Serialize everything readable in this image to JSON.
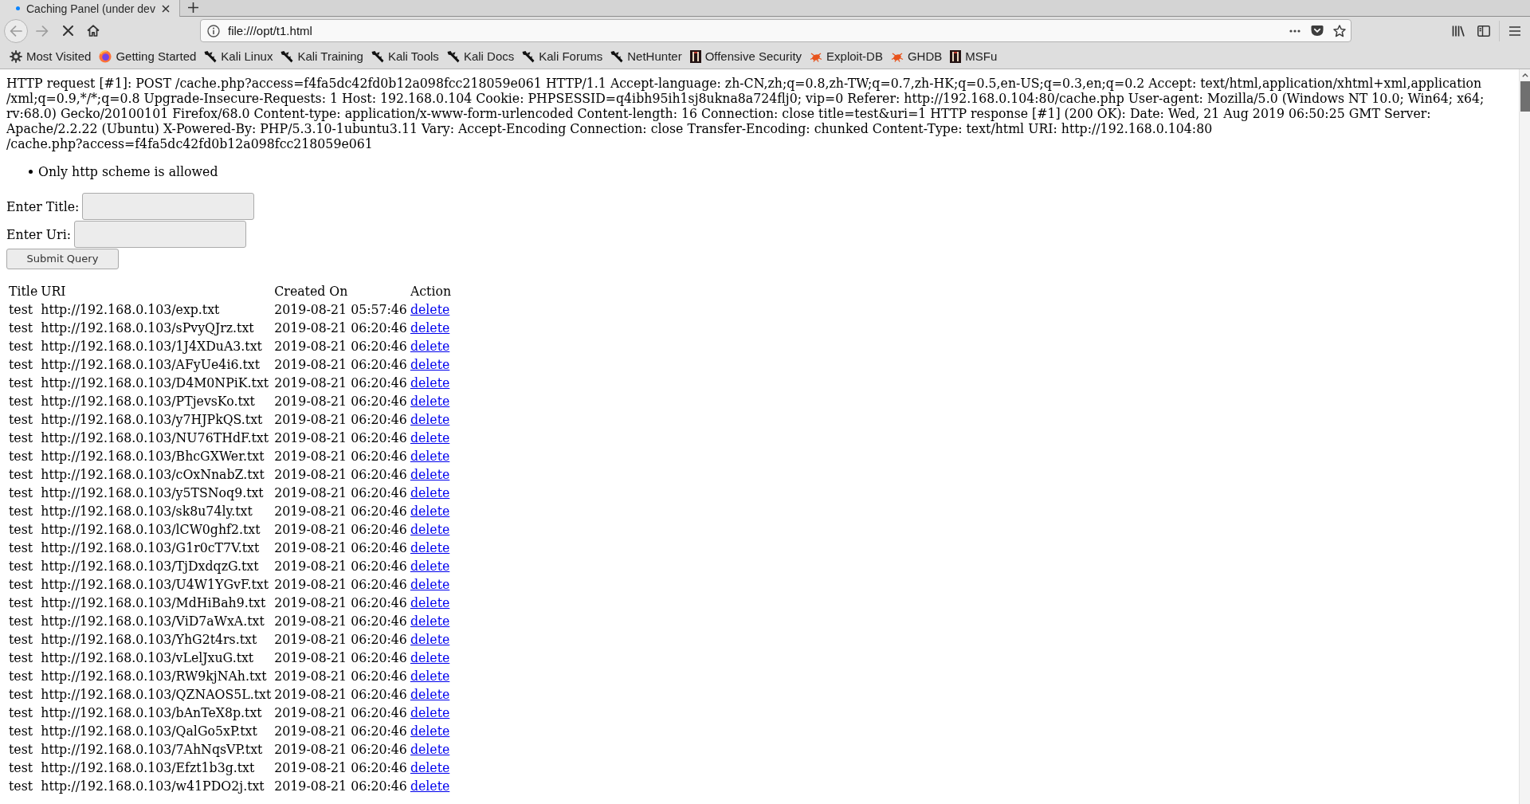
{
  "browser": {
    "tabs": [
      {
        "title": "Caching Panel (under dev",
        "selected": true
      }
    ],
    "navigation": {
      "back_disabled": true,
      "forward_disabled": true,
      "loading": true
    },
    "address": {
      "value": "file:///opt/t1.html"
    },
    "bookmarks": [
      {
        "label": "Most Visited",
        "kind": "gear"
      },
      {
        "label": "Getting Started",
        "kind": "globe"
      },
      {
        "label": "Kali Linux",
        "kind": "dragon"
      },
      {
        "label": "Kali Training",
        "kind": "dragon"
      },
      {
        "label": "Kali Tools",
        "kind": "dragon"
      },
      {
        "label": "Kali Docs",
        "kind": "dragon"
      },
      {
        "label": "Kali Forums",
        "kind": "dragon"
      },
      {
        "label": "NetHunter",
        "kind": "dragon"
      },
      {
        "label": "Offensive Security",
        "kind": "tile"
      },
      {
        "label": "Exploit-DB",
        "kind": "bug"
      },
      {
        "label": "GHDB",
        "kind": "bug"
      },
      {
        "label": "MSFu",
        "kind": "tile"
      }
    ]
  },
  "page": {
    "request_log": {
      "lines": [
        "HTTP request [#1]: POST /cache.php?access=f4fa5dc42fd0b12a098fcc218059e061 HTTP/1.1 Accept-language: zh-CN,zh;q=0.8,zh-TW;q=0.7,zh-HK;q=0.5,en-US;q=0.3,en;q=0.2 Accept: text/html,application/xhtml+xml,application",
        "/xml;q=0.9,*/*;q=0.8 Upgrade-Insecure-Requests: 1 Host: 192.168.0.104 Cookie: PHPSESSID=q4ibh95ih1sj8ukna8a724flj0; vip=0 Referer: http://192.168.0.104:80/cache.php User-agent: Mozilla/5.0 (Windows NT 10.0; Win64; x64;",
        "rv:68.0) Gecko/20100101 Firefox/68.0 Content-type: application/x-www-form-urlencoded Content-length: 16 Connection: close title=test&uri=1 HTTP response [#1] (200 OK): Date: Wed, 21 Aug 2019 06:50:25 GMT Server:",
        "Apache/2.2.22 (Ubuntu) X-Powered-By: PHP/5.3.10-1ubuntu3.11 Vary: Accept-Encoding Connection: close Transfer-Encoding: chunked Content-Type: text/html URI: http://192.168.0.104:80",
        "/cache.php?access=f4fa5dc42fd0b12a098fcc218059e061"
      ]
    },
    "errors": [
      "Only http scheme is allowed"
    ],
    "form": {
      "fields": [
        {
          "label": "Enter Title:"
        },
        {
          "label": "Enter Uri:"
        }
      ],
      "submit": "Submit Query"
    },
    "table": {
      "columns": [
        "Title",
        "URI",
        "Created On",
        "Action"
      ],
      "rows": [
        [
          "test",
          "http://192.168.0.103/exp.txt",
          "2019-08-21 05:57:46",
          "delete"
        ],
        [
          "test",
          "http://192.168.0.103/sPvyQJrz.txt",
          "2019-08-21 06:20:46",
          "delete"
        ],
        [
          "test",
          "http://192.168.0.103/1J4XDuA3.txt",
          "2019-08-21 06:20:46",
          "delete"
        ],
        [
          "test",
          "http://192.168.0.103/AFyUe4i6.txt",
          "2019-08-21 06:20:46",
          "delete"
        ],
        [
          "test",
          "http://192.168.0.103/D4M0NPiK.txt",
          "2019-08-21 06:20:46",
          "delete"
        ],
        [
          "test",
          "http://192.168.0.103/PTjevsKo.txt",
          "2019-08-21 06:20:46",
          "delete"
        ],
        [
          "test",
          "http://192.168.0.103/y7HJPkQS.txt",
          "2019-08-21 06:20:46",
          "delete"
        ],
        [
          "test",
          "http://192.168.0.103/NU76THdF.txt",
          "2019-08-21 06:20:46",
          "delete"
        ],
        [
          "test",
          "http://192.168.0.103/BhcGXWer.txt",
          "2019-08-21 06:20:46",
          "delete"
        ],
        [
          "test",
          "http://192.168.0.103/cOxNnabZ.txt",
          "2019-08-21 06:20:46",
          "delete"
        ],
        [
          "test",
          "http://192.168.0.103/y5TSNoq9.txt",
          "2019-08-21 06:20:46",
          "delete"
        ],
        [
          "test",
          "http://192.168.0.103/sk8u74ly.txt",
          "2019-08-21 06:20:46",
          "delete"
        ],
        [
          "test",
          "http://192.168.0.103/lCW0ghf2.txt",
          "2019-08-21 06:20:46",
          "delete"
        ],
        [
          "test",
          "http://192.168.0.103/G1r0cT7V.txt",
          "2019-08-21 06:20:46",
          "delete"
        ],
        [
          "test",
          "http://192.168.0.103/TjDxdqzG.txt",
          "2019-08-21 06:20:46",
          "delete"
        ],
        [
          "test",
          "http://192.168.0.103/U4W1YGvF.txt",
          "2019-08-21 06:20:46",
          "delete"
        ],
        [
          "test",
          "http://192.168.0.103/MdHiBah9.txt",
          "2019-08-21 06:20:46",
          "delete"
        ],
        [
          "test",
          "http://192.168.0.103/ViD7aWxA.txt",
          "2019-08-21 06:20:46",
          "delete"
        ],
        [
          "test",
          "http://192.168.0.103/YhG2t4rs.txt",
          "2019-08-21 06:20:46",
          "delete"
        ],
        [
          "test",
          "http://192.168.0.103/vLelJxuG.txt",
          "2019-08-21 06:20:46",
          "delete"
        ],
        [
          "test",
          "http://192.168.0.103/RW9kjNAh.txt",
          "2019-08-21 06:20:46",
          "delete"
        ],
        [
          "test",
          "http://192.168.0.103/QZNAOS5L.txt",
          "2019-08-21 06:20:46",
          "delete"
        ],
        [
          "test",
          "http://192.168.0.103/bAnTeX8p.txt",
          "2019-08-21 06:20:46",
          "delete"
        ],
        [
          "test",
          "http://192.168.0.103/QalGo5xP.txt",
          "2019-08-21 06:20:46",
          "delete"
        ],
        [
          "test",
          "http://192.168.0.103/7AhNqsVP.txt",
          "2019-08-21 06:20:46",
          "delete"
        ],
        [
          "test",
          "http://192.168.0.103/Efzt1b3g.txt",
          "2019-08-21 06:20:46",
          "delete"
        ],
        [
          "test",
          "http://192.168.0.103/w41PDO2j.txt",
          "2019-08-21 06:20:46",
          "delete"
        ]
      ]
    }
  }
}
